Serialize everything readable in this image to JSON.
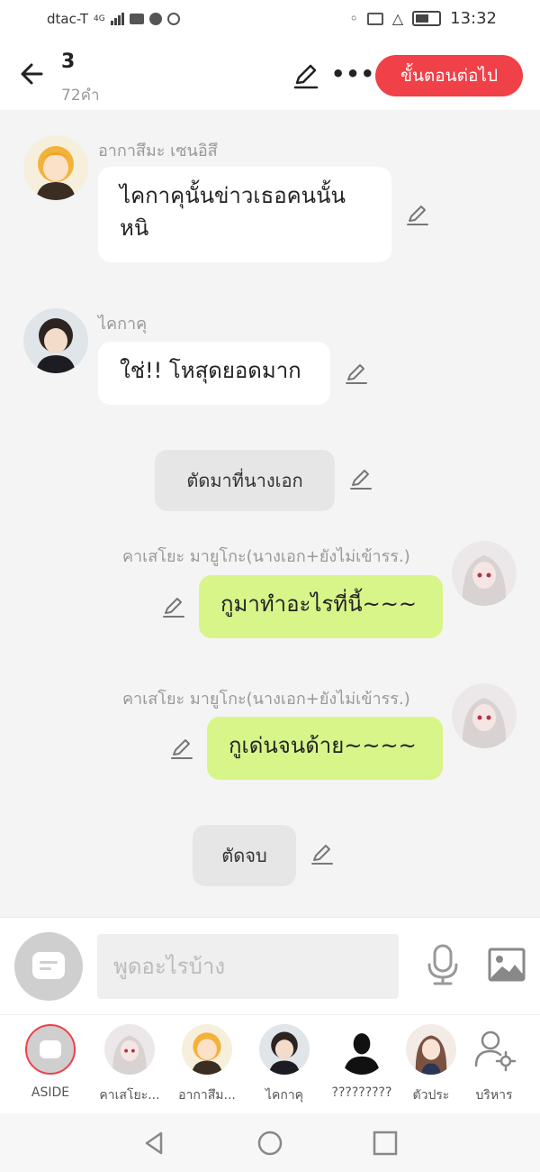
{
  "status_bar": {
    "carrier": "dtac-T",
    "network": "4G",
    "time": "13:32"
  },
  "header": {
    "title": "3",
    "word_count": "72คำ",
    "next_label": "ขั้นตอนต่อไป"
  },
  "messages": [
    {
      "type": "received",
      "name": "อากาสึมะ เซนอิสึ",
      "text": "ไคกาคุนั้นข่าวเธอคนนั้นหนิ",
      "avatar": "blonde-boy"
    },
    {
      "type": "received",
      "name": "ไคกาคุ",
      "text": "ใช่!! โหสุดยอดมาก",
      "avatar": "dark-hair-boy"
    },
    {
      "type": "narration",
      "text": "ตัดมาที่นางเอก"
    },
    {
      "type": "sent",
      "name": "คาเสโยะ มายูโกะ(นางเอก+ยังไม่เข้ารร.)",
      "text": "กูมาทำอะไรที่นี้~~~",
      "avatar": "silver-hair-girl"
    },
    {
      "type": "sent",
      "name": "คาเสโยะ มายูโกะ(นางเอก+ยังไม่เข้ารร.)",
      "text": "กูเด่นจนด้าย~~~~",
      "avatar": "silver-hair-girl"
    },
    {
      "type": "narration",
      "text": "ตัดจบ"
    }
  ],
  "input": {
    "placeholder": "พูดอะไรบ้าง"
  },
  "characters": [
    {
      "label": "ASIDE",
      "kind": "aside"
    },
    {
      "label": "คาเสโยะ...",
      "kind": "silver-hair-girl"
    },
    {
      "label": "อากาสึม...",
      "kind": "blonde-boy"
    },
    {
      "label": "ไคกาคุ",
      "kind": "dark-hair-boy"
    },
    {
      "label": "?????????",
      "kind": "silhouette"
    },
    {
      "label": "ตัวประ",
      "kind": "brown-hair-girl"
    },
    {
      "label": "บริหาร",
      "kind": "manage"
    }
  ],
  "colors": {
    "accent": "#f04048",
    "sent_bubble": "#d8f58a",
    "chat_bg": "#f4f4f4"
  }
}
